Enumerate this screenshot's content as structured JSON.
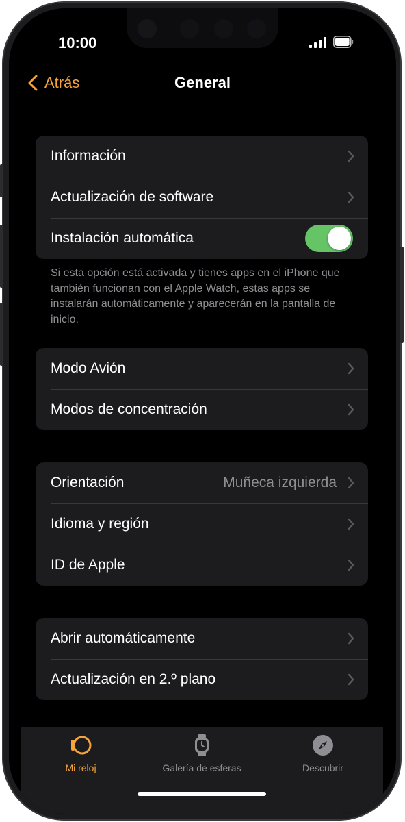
{
  "status_bar": {
    "time": "10:00"
  },
  "nav": {
    "back_label": "Atrás",
    "title": "General"
  },
  "groups": [
    {
      "rows": [
        {
          "label": "Información"
        },
        {
          "label": "Actualización de software"
        },
        {
          "label": "Instalación automática",
          "toggle_on": true
        }
      ],
      "footnote": "Si esta opción está activada y tienes apps en el iPhone que también funcionan con el Apple Watch, estas apps se instalarán automáticamente y aparecerán en la pantalla de inicio."
    },
    {
      "rows": [
        {
          "label": "Modo Avión"
        },
        {
          "label": "Modos de concentración"
        }
      ]
    },
    {
      "rows": [
        {
          "label": "Orientación",
          "value": "Muñeca izquierda"
        },
        {
          "label": "Idioma y región"
        },
        {
          "label": "ID de Apple"
        }
      ]
    },
    {
      "rows": [
        {
          "label": "Abrir automáticamente"
        },
        {
          "label": "Actualización en 2.º plano"
        }
      ]
    }
  ],
  "tabs": [
    {
      "label": "Mi reloj",
      "icon": "watch-icon",
      "active": true
    },
    {
      "label": "Galería de esferas",
      "icon": "watch-face-icon",
      "active": false
    },
    {
      "label": "Descubrir",
      "icon": "compass-icon",
      "active": false
    }
  ],
  "colors": {
    "accent": "#f5a33b",
    "toggle_on": "#65c466",
    "background": "#000000",
    "cell": "#1c1c1e",
    "secondary_text": "#8e8e93"
  }
}
